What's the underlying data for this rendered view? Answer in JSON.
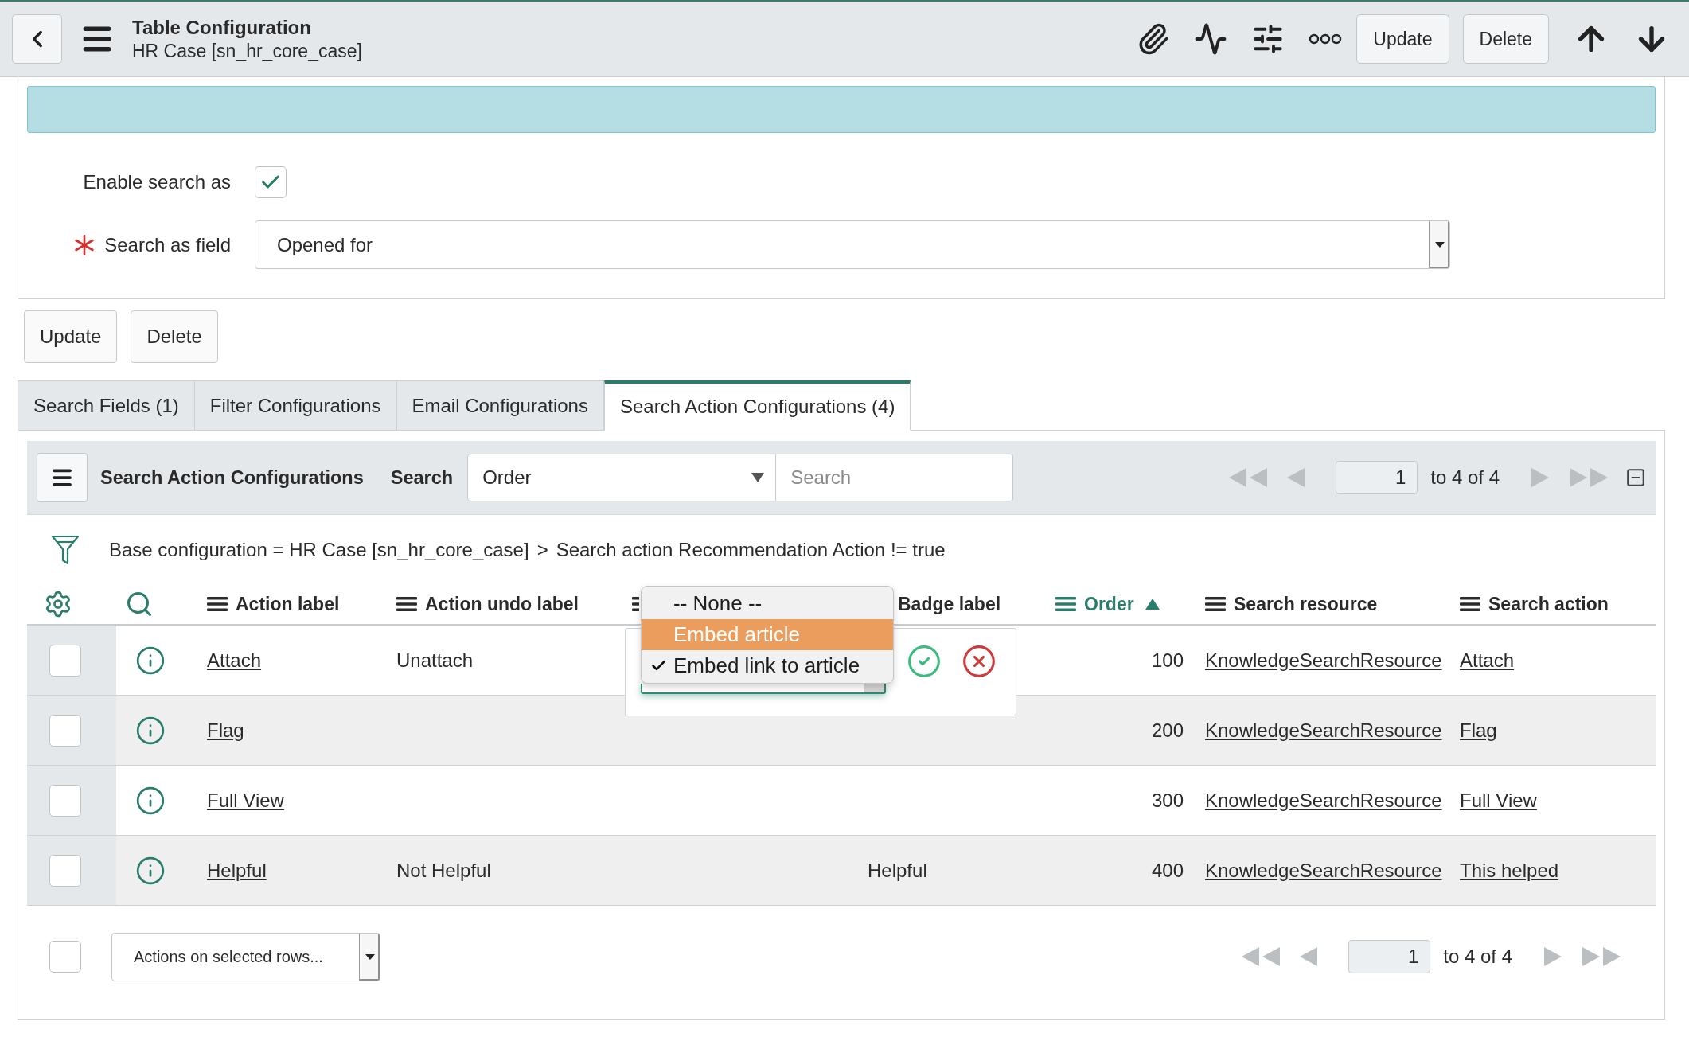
{
  "header": {
    "title": "Table Configuration",
    "subtitle": "HR Case [sn_hr_core_case]",
    "buttons": [
      "Update",
      "Delete"
    ]
  },
  "form": {
    "fields": [
      {
        "kind": "checkbox",
        "label": "Enable search as",
        "required": false,
        "checked": true
      },
      {
        "kind": "select",
        "label": "Search as field",
        "required": true,
        "value": "Opened for"
      }
    ],
    "buttons": [
      "Update",
      "Delete"
    ]
  },
  "tabs": [
    {
      "label": "Search Fields (1)",
      "selected": false
    },
    {
      "label": "Filter Configurations",
      "selected": false
    },
    {
      "label": "Email Configurations",
      "selected": false
    },
    {
      "label": "Search Action Configurations (4)",
      "selected": true
    }
  ],
  "list": {
    "title": "Search Action Configurations",
    "search": {
      "label": "Search",
      "field": "Order",
      "placeholder": "Search"
    },
    "pagination": {
      "page": "1",
      "range": "to 4 of 4"
    },
    "filter": {
      "conditions": [
        "Base configuration = HR Case [sn_hr_core_case]",
        "Search action Recommendation Action != true"
      ],
      "separator": ">"
    },
    "columns": [
      {
        "label": "Action label",
        "menu": true,
        "sorted": false
      },
      {
        "label": "Action undo label",
        "menu": true,
        "sorted": false
      },
      {
        "menu": true,
        "sorted": false
      },
      {
        "label": "Badge label",
        "menu": false,
        "sorted": false
      },
      {
        "label": "Order",
        "menu": true,
        "sorted": true
      },
      {
        "label": "Search resource",
        "menu": true,
        "sorted": false
      },
      {
        "label": "Search action",
        "menu": true,
        "sorted": false
      }
    ],
    "rows": [
      {
        "checked": false,
        "action_label": "Attach",
        "action_undo_label": "Unattach",
        "order": "100",
        "search_resource": "KnowledgeSearchResource",
        "search_action": "Attach",
        "editor": {
          "options": [
            {
              "label": "-- None --",
              "selected": false,
              "highlighted": false
            },
            {
              "label": "Embed article",
              "selected": false,
              "highlighted": true
            },
            {
              "label": "Embed link to article",
              "selected": true,
              "highlighted": false
            }
          ]
        }
      },
      {
        "checked": false,
        "action_label": "Flag",
        "order": "200",
        "search_resource": "KnowledgeSearchResource",
        "search_action": "Flag"
      },
      {
        "checked": false,
        "action_label": "Full View",
        "order": "300",
        "search_resource": "KnowledgeSearchResource",
        "search_action": "Full View"
      },
      {
        "checked": false,
        "action_label": "Helpful",
        "action_undo_label": "Not Helpful",
        "badge_label": "Helpful",
        "order": "400",
        "search_resource": "KnowledgeSearchResource",
        "search_action": "This helped"
      }
    ]
  },
  "footer": {
    "checked": false,
    "actions": "Actions on selected rows...",
    "pagination": {
      "page": "1",
      "range": "to 4 of 4"
    }
  }
}
